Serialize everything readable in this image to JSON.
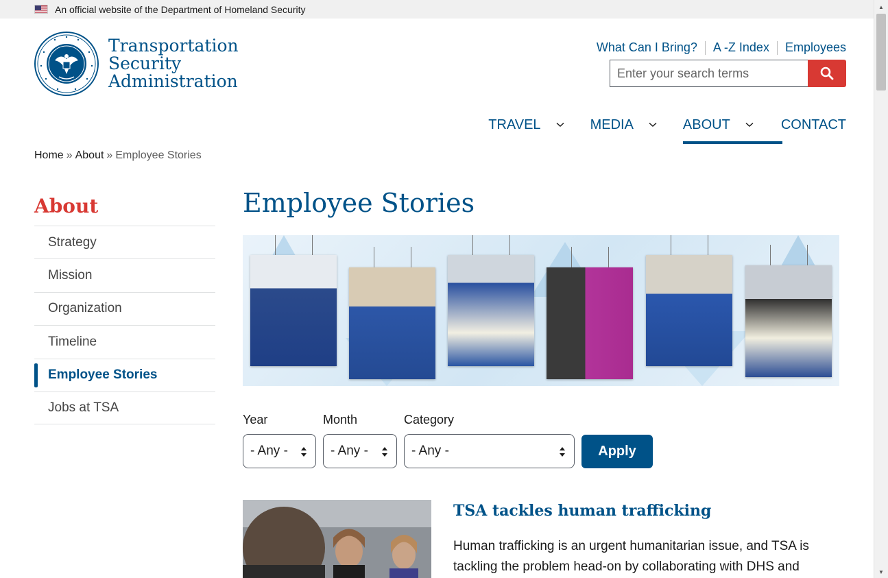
{
  "gov_banner": {
    "text": "An official website of the Department of Homeland Security"
  },
  "logo": {
    "line1": "Transportation",
    "line2": "Security",
    "line3": "Administration"
  },
  "utility_nav": [
    {
      "label": "What Can I Bring?"
    },
    {
      "label": "A -Z Index"
    },
    {
      "label": "Employees"
    }
  ],
  "search": {
    "placeholder": "Enter your search terms"
  },
  "main_nav": [
    {
      "label": "TRAVEL",
      "has_dropdown": true
    },
    {
      "label": "MEDIA",
      "has_dropdown": true
    },
    {
      "label": "ABOUT",
      "has_dropdown": true,
      "active": true
    },
    {
      "label": "CONTACT",
      "has_dropdown": false
    }
  ],
  "breadcrumb": {
    "home": "Home",
    "about": "About",
    "current": "Employee Stories",
    "separator": "»"
  },
  "sidebar": {
    "title": "About",
    "items": [
      {
        "label": "Strategy"
      },
      {
        "label": "Mission"
      },
      {
        "label": "Organization"
      },
      {
        "label": "Timeline"
      },
      {
        "label": "Employee Stories",
        "current": true
      },
      {
        "label": "Jobs at TSA"
      }
    ]
  },
  "page": {
    "title": "Employee Stories"
  },
  "filters": {
    "year": {
      "label": "Year",
      "value": "- Any -"
    },
    "month": {
      "label": "Month",
      "value": "- Any -"
    },
    "category": {
      "label": "Category",
      "value": "- Any -"
    },
    "apply_label": "Apply"
  },
  "stories": [
    {
      "title": "TSA tackles human trafficking",
      "summary_line1": "Human trafficking is an urgent humanitarian issue, and TSA is",
      "summary_line2": "tackling the problem head-on by collaborating with DHS and"
    }
  ],
  "colors": {
    "brand_blue": "#005288",
    "accent_red": "#d83933",
    "text": "#1b1b1b"
  }
}
